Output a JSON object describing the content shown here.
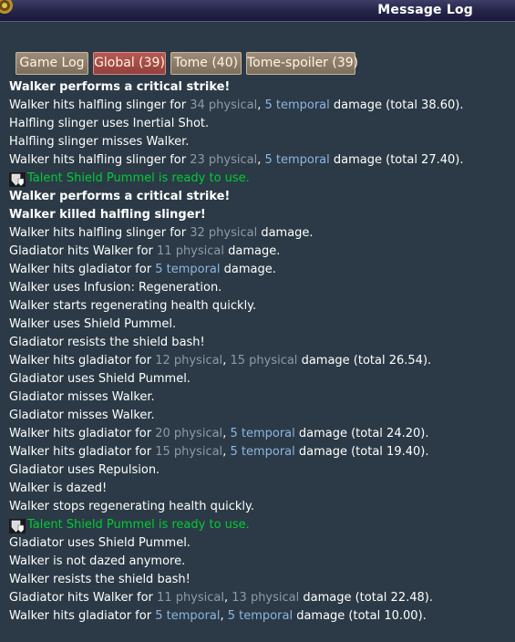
{
  "window": {
    "title": "Message Log"
  },
  "tabs": [
    {
      "label": "Game Log",
      "active": false
    },
    {
      "label": "Global (39)",
      "active": true
    },
    {
      "label": "Tome (40)",
      "active": false
    },
    {
      "label": "Tome-spoiler (39)",
      "active": false
    }
  ],
  "colors": {
    "background": "#2b3a46",
    "physical": "#8f9aa6",
    "temporal": "#8fb6e0",
    "talent_ready": "#00cc33",
    "active_tab": "#a34b45"
  },
  "log": [
    {
      "style": "bold",
      "parts": [
        {
          "t": "Walker performs a critical strike!"
        }
      ]
    },
    {
      "style": "normal",
      "parts": [
        {
          "t": "Walker hits halfling slinger for "
        },
        {
          "t": "34 physical",
          "c": "physical"
        },
        {
          "t": ", "
        },
        {
          "t": "5 temporal",
          "c": "temporal"
        },
        {
          "t": " damage (total 38.60)."
        }
      ]
    },
    {
      "style": "normal",
      "parts": [
        {
          "t": "Halfling slinger uses Inertial Shot."
        }
      ]
    },
    {
      "style": "normal",
      "parts": [
        {
          "t": "Halfling slinger misses Walker."
        }
      ]
    },
    {
      "style": "normal",
      "parts": [
        {
          "t": "Walker hits halfling slinger for "
        },
        {
          "t": "23 physical",
          "c": "physical"
        },
        {
          "t": ", "
        },
        {
          "t": "5 temporal",
          "c": "temporal"
        },
        {
          "t": " damage (total 27.40)."
        }
      ]
    },
    {
      "style": "green",
      "icon": "shield-pummel-icon",
      "parts": [
        {
          "t": "Talent Shield Pummel is ready to use."
        }
      ]
    },
    {
      "style": "bold",
      "parts": [
        {
          "t": "Walker performs a critical strike!"
        }
      ]
    },
    {
      "style": "bold",
      "parts": [
        {
          "t": "Walker killed halfling slinger!"
        }
      ]
    },
    {
      "style": "normal",
      "parts": [
        {
          "t": "Walker hits halfling slinger for "
        },
        {
          "t": "32 physical",
          "c": "physical"
        },
        {
          "t": " damage."
        }
      ]
    },
    {
      "style": "normal",
      "parts": [
        {
          "t": "Gladiator hits Walker for "
        },
        {
          "t": "11 physical",
          "c": "physical"
        },
        {
          "t": " damage."
        }
      ]
    },
    {
      "style": "normal",
      "parts": [
        {
          "t": "Walker hits gladiator for "
        },
        {
          "t": "5 temporal",
          "c": "temporal"
        },
        {
          "t": " damage."
        }
      ]
    },
    {
      "style": "normal",
      "parts": [
        {
          "t": "Walker uses Infusion: Regeneration."
        }
      ]
    },
    {
      "style": "normal",
      "parts": [
        {
          "t": "Walker starts regenerating health quickly."
        }
      ]
    },
    {
      "style": "normal",
      "parts": [
        {
          "t": "Walker uses Shield Pummel."
        }
      ]
    },
    {
      "style": "normal",
      "parts": [
        {
          "t": "Gladiator resists the shield bash!"
        }
      ]
    },
    {
      "style": "normal",
      "parts": [
        {
          "t": "Walker hits gladiator for "
        },
        {
          "t": "12 physical",
          "c": "physical"
        },
        {
          "t": ", "
        },
        {
          "t": "15 physical",
          "c": "physical"
        },
        {
          "t": " damage (total 26.54)."
        }
      ]
    },
    {
      "style": "normal",
      "parts": [
        {
          "t": "Gladiator uses Shield Pummel."
        }
      ]
    },
    {
      "style": "normal",
      "parts": [
        {
          "t": "Gladiator misses Walker."
        }
      ]
    },
    {
      "style": "normal",
      "parts": [
        {
          "t": "Gladiator misses Walker."
        }
      ]
    },
    {
      "style": "normal",
      "parts": [
        {
          "t": "Walker hits gladiator for "
        },
        {
          "t": "20 physical",
          "c": "physical"
        },
        {
          "t": ", "
        },
        {
          "t": "5 temporal",
          "c": "temporal"
        },
        {
          "t": " damage (total 24.20)."
        }
      ]
    },
    {
      "style": "normal",
      "parts": [
        {
          "t": "Walker hits gladiator for "
        },
        {
          "t": "15 physical",
          "c": "physical"
        },
        {
          "t": ", "
        },
        {
          "t": "5 temporal",
          "c": "temporal"
        },
        {
          "t": " damage (total 19.40)."
        }
      ]
    },
    {
      "style": "normal",
      "parts": [
        {
          "t": "Gladiator uses Repulsion."
        }
      ]
    },
    {
      "style": "normal",
      "parts": [
        {
          "t": "Walker is dazed!"
        }
      ]
    },
    {
      "style": "normal",
      "parts": [
        {
          "t": "Walker stops regenerating health quickly."
        }
      ]
    },
    {
      "style": "green",
      "icon": "shield-pummel-icon",
      "parts": [
        {
          "t": "Talent Shield Pummel is ready to use."
        }
      ]
    },
    {
      "style": "normal",
      "parts": [
        {
          "t": "Gladiator uses Shield Pummel."
        }
      ]
    },
    {
      "style": "normal",
      "parts": [
        {
          "t": "Walker is not dazed anymore."
        }
      ]
    },
    {
      "style": "normal",
      "parts": [
        {
          "t": "Walker resists the shield bash!"
        }
      ]
    },
    {
      "style": "normal",
      "parts": [
        {
          "t": "Gladiator hits Walker for "
        },
        {
          "t": "11 physical",
          "c": "physical"
        },
        {
          "t": ", "
        },
        {
          "t": "13 physical",
          "c": "physical"
        },
        {
          "t": " damage (total 22.48)."
        }
      ]
    },
    {
      "style": "normal",
      "parts": [
        {
          "t": "Walker hits gladiator for "
        },
        {
          "t": "5 temporal",
          "c": "temporal"
        },
        {
          "t": ", "
        },
        {
          "t": "5 temporal",
          "c": "temporal"
        },
        {
          "t": " damage (total 10.00)."
        }
      ]
    }
  ]
}
